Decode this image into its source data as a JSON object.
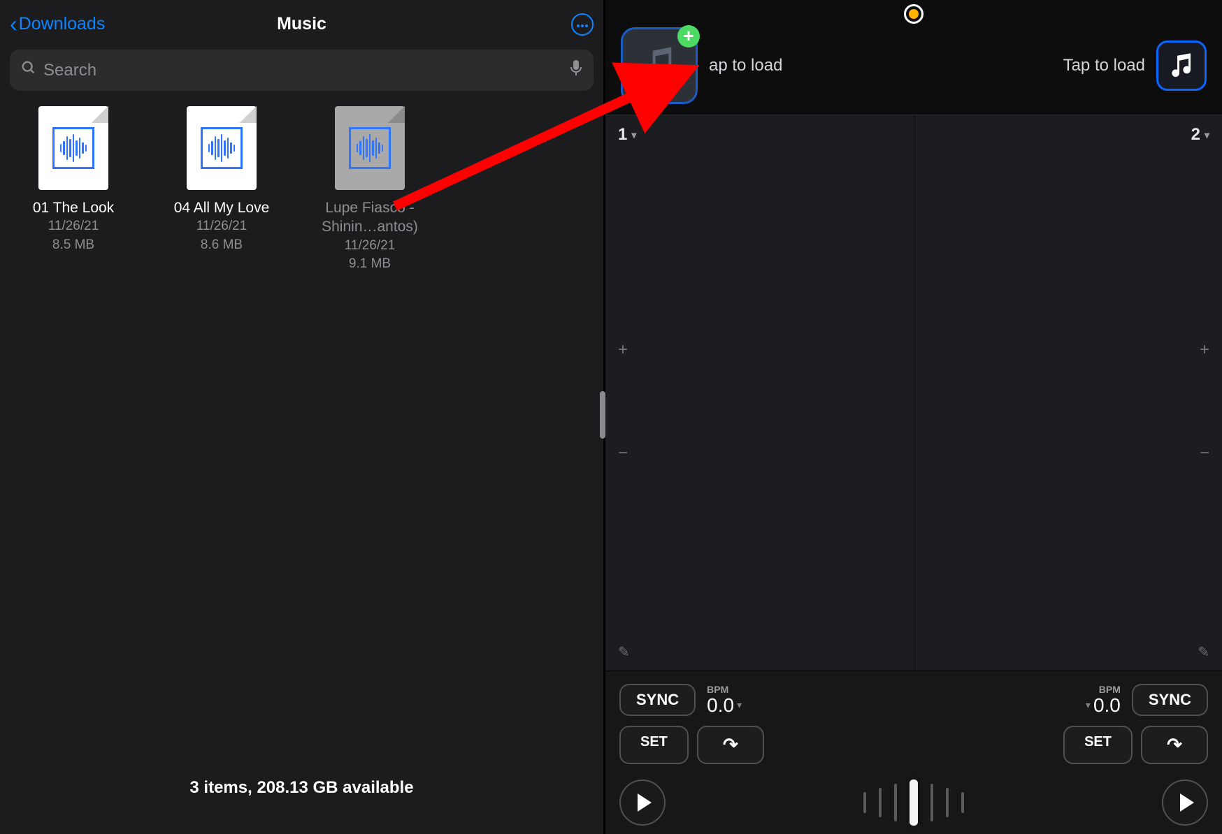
{
  "files": {
    "back_label": "Downloads",
    "title": "Music",
    "search_placeholder": "Search",
    "items": [
      {
        "name": "01 The Look",
        "date": "11/26/21",
        "size": "8.5 MB",
        "dimmed": false
      },
      {
        "name": "04 All My Love",
        "date": "11/26/21",
        "size": "8.6 MB",
        "dimmed": false
      },
      {
        "name": "Lupe Fiasco - Shinin…antos)",
        "date": "11/26/21",
        "size": "9.1 MB",
        "dimmed": true
      }
    ],
    "footer": "3 items, 208.13 GB available"
  },
  "dj": {
    "load_label_left": "ap to load",
    "load_label_right": "Tap to load",
    "deck_left_num": "1",
    "deck_right_num": "2",
    "sync_label": "SYNC",
    "set_label": "SET",
    "bpm_label": "BPM",
    "bpm_value_left": "0.0",
    "bpm_value_right": "0.0"
  }
}
